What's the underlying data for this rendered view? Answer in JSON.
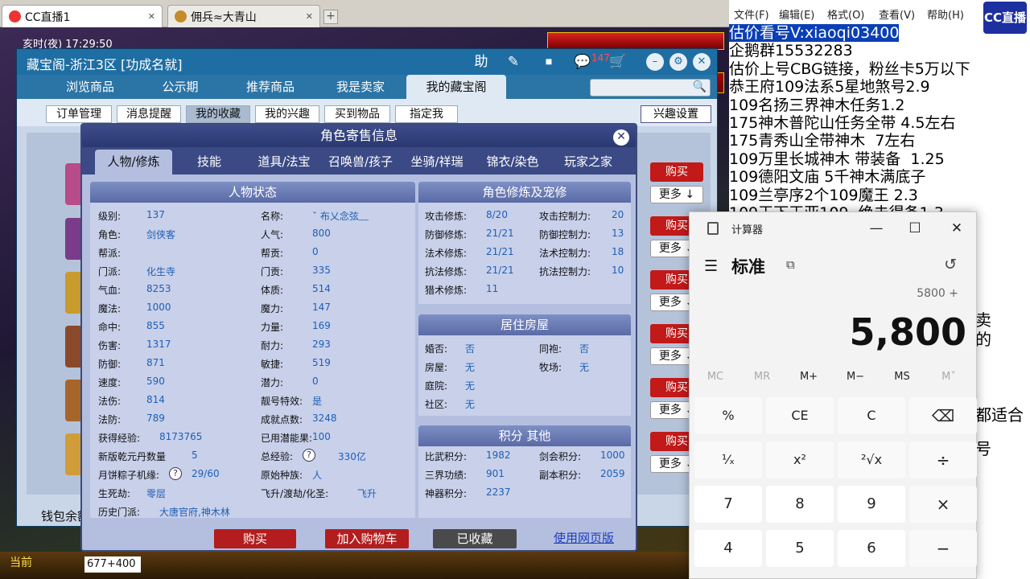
{
  "browser": {
    "tabs": [
      {
        "title": "CC直播1",
        "close": "✕"
      },
      {
        "title": "佣兵≈大青山",
        "close": "✕"
      }
    ],
    "new_tab": "+"
  },
  "game": {
    "hud_time": "亥时(夜) 17:29:50",
    "status_bar_text": "当前",
    "chat_input": "677+400"
  },
  "window": {
    "title": "藏宝阁-浙江3区 [功成名就]",
    "title_buttons": [
      "助",
      "✎",
      "⏹",
      "💬",
      "🛒",
      "–",
      "⚙",
      "✕"
    ],
    "message_count": "147",
    "nav_tabs": [
      "浏览商品",
      "公示期",
      "推荐商品",
      "我是卖家",
      "我的藏宝阁"
    ],
    "active_nav": 4,
    "search_icon": "🔍",
    "sub_tabs": [
      "订单管理",
      "消息提醒",
      "我的收藏",
      "我的兴趣",
      "买到物品",
      "指定我"
    ],
    "active_sub": 2,
    "interest_button": "兴趣设置",
    "buy_label": "购买",
    "more_label": "更多 ↓",
    "wallet_label": "钱包余额"
  },
  "modal": {
    "title": "角色寄售信息",
    "close": "✕",
    "tabs": [
      "人物/修炼",
      "技能",
      "道具/法宝",
      "召唤兽/孩子",
      "坐骑/祥瑞",
      "锦衣/染色",
      "玩家之家"
    ],
    "active_tab": 0,
    "status_panel": {
      "title": "人物状态",
      "left": [
        {
          "k": "级别:",
          "v": "137"
        },
        {
          "k": "角色:",
          "v": "剑侠客"
        },
        {
          "k": "帮派:",
          "v": ""
        },
        {
          "k": "门派:",
          "v": "化生寺"
        },
        {
          "k": "气血:",
          "v": "8253"
        },
        {
          "k": "魔法:",
          "v": "1000"
        },
        {
          "k": "命中:",
          "v": "855"
        },
        {
          "k": "伤害:",
          "v": "1317"
        },
        {
          "k": "防御:",
          "v": "871"
        },
        {
          "k": "速度:",
          "v": "590"
        },
        {
          "k": "法伤:",
          "v": "814"
        },
        {
          "k": "法防:",
          "v": "789"
        },
        {
          "k": "获得经验:",
          "v": "8173765"
        },
        {
          "k": "新版乾元丹数量",
          "v": "5"
        },
        {
          "k": "月饼粽子机缘:",
          "v": "29/60"
        },
        {
          "k": "生死劫:",
          "v": "零层"
        },
        {
          "k": "历史门派:",
          "v": "大唐官府,神木林"
        }
      ],
      "right": [
        {
          "k": "名称:",
          "v": "ˇ 布乂念弦﹏"
        },
        {
          "k": "人气:",
          "v": "800"
        },
        {
          "k": "帮贡:",
          "v": "0"
        },
        {
          "k": "门贡:",
          "v": "335"
        },
        {
          "k": "体质:",
          "v": "514"
        },
        {
          "k": "魔力:",
          "v": "147"
        },
        {
          "k": "力量:",
          "v": "169"
        },
        {
          "k": "耐力:",
          "v": "293"
        },
        {
          "k": "敏捷:",
          "v": "519"
        },
        {
          "k": "潜力:",
          "v": "0"
        },
        {
          "k": "靓号特效:",
          "v": "是"
        },
        {
          "k": "成就点数:",
          "v": "3248"
        },
        {
          "k": "已用潜能果:",
          "v": "100"
        },
        {
          "k": "总经验:",
          "v": "330亿"
        },
        {
          "k": "原始种族:",
          "v": "人"
        },
        {
          "k": "飞升/渡劫/化圣:",
          "v": "飞升"
        }
      ]
    },
    "cultivation_panel": {
      "title": "角色修炼及宠修",
      "left": [
        {
          "k": "攻击修炼:",
          "v": "8/20"
        },
        {
          "k": "防御修炼:",
          "v": "21/21"
        },
        {
          "k": "法术修炼:",
          "v": "21/21"
        },
        {
          "k": "抗法修炼:",
          "v": "21/21"
        },
        {
          "k": "猎术修炼:",
          "v": "11"
        }
      ],
      "right": [
        {
          "k": "攻击控制力:",
          "v": "20"
        },
        {
          "k": "防御控制力:",
          "v": "13"
        },
        {
          "k": "法术控制力:",
          "v": "18"
        },
        {
          "k": "抗法控制力:",
          "v": "10"
        }
      ]
    },
    "house_panel": {
      "title": "居住房屋",
      "left": [
        {
          "k": "婚否:",
          "v": "否"
        },
        {
          "k": "房屋:",
          "v": "无"
        },
        {
          "k": "庭院:",
          "v": "无"
        },
        {
          "k": "社区:",
          "v": "无"
        }
      ],
      "right": [
        {
          "k": "同袍:",
          "v": "否"
        },
        {
          "k": "牧场:",
          "v": "无"
        }
      ]
    },
    "score_panel": {
      "title": "积分 其他",
      "left": [
        {
          "k": "比武积分:",
          "v": "1982"
        },
        {
          "k": "三界功绩:",
          "v": "901"
        },
        {
          "k": "神器积分:",
          "v": "2237"
        }
      ],
      "right": [
        {
          "k": "剑会积分:",
          "v": "1000"
        },
        {
          "k": "副本积分:",
          "v": "2059"
        }
      ]
    },
    "buttons": {
      "buy": "购买",
      "add_cart": "加入购物车",
      "collected": "已收藏",
      "web": "使用网页版"
    },
    "help_glyph": "?"
  },
  "notepad": {
    "menu": [
      "文件(F)",
      "编辑(E)",
      "格式(O)",
      "查看(V)",
      "帮助(H)"
    ],
    "lines": [
      "估价看号V:xiaoqi03400",
      "企鹅群15532283",
      "估价上号CBG链接，粉丝卡5万以下",
      "恭王府109法系5星地煞号2.9",
      "109名扬三界神木任务1.2",
      "175神木普陀山任务全带 4.5左右",
      "175青秀山全带神木  7左右",
      "109万里长城神木 带装备  1.25",
      "109德阳文庙 5千神木满底子",
      "109兰亭序2个109魔王 2.3",
      "109王下王亚109  绝击得备1.3"
    ],
    "side_fragments": [
      "卖",
      "的",
      "",
      "",
      "都适合",
      "号"
    ],
    "sticker": "CC直播"
  },
  "calculator": {
    "app_title": "计算器",
    "window_controls": [
      "—",
      "☐",
      "✕"
    ],
    "menu_icon": "☰",
    "mode": "标准",
    "keep_on_top_icon": "⧉",
    "history_icon": "↺",
    "expression": "5800 +",
    "display": "5,800",
    "memory": [
      "MC",
      "MR",
      "M+",
      "M−",
      "MS",
      "M˅"
    ],
    "keys": [
      [
        "%",
        "CE",
        "C",
        "⌫"
      ],
      [
        "¹⁄ₓ",
        "x²",
        "²√x",
        "÷"
      ],
      [
        "7",
        "8",
        "9",
        "×"
      ],
      [
        "4",
        "5",
        "6",
        "−"
      ]
    ]
  }
}
